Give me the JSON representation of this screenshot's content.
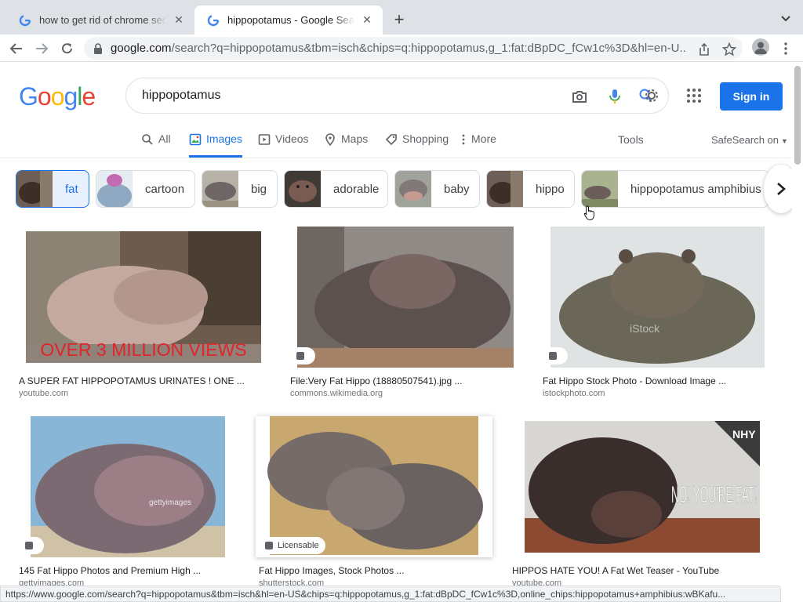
{
  "browser": {
    "tabs": [
      {
        "title": "how to get rid of chrome secur",
        "active": false
      },
      {
        "title": "hippopotamus - Google Search",
        "active": true
      }
    ],
    "url_host": "google.com",
    "url_path": "/search?q=hippopotamus&tbm=isch&chips=q:hippopotamus,g_1:fat:dBpDC_fCw1c%3D&hl=en-U..."
  },
  "header": {
    "logo": "Google",
    "query": "hippopotamus",
    "signin_label": "Sign in"
  },
  "nav": {
    "tabs": [
      {
        "label": "All",
        "icon": "search-icon"
      },
      {
        "label": "Images",
        "icon": "image-icon",
        "active": true
      },
      {
        "label": "Videos",
        "icon": "video-icon"
      },
      {
        "label": "Maps",
        "icon": "map-pin-icon"
      },
      {
        "label": "Shopping",
        "icon": "tag-icon"
      },
      {
        "label": "More",
        "icon": "more-vert-icon"
      }
    ],
    "tools": "Tools",
    "safesearch": "SafeSearch on"
  },
  "chips": [
    {
      "label": "fat",
      "selected": true
    },
    {
      "label": "cartoon"
    },
    {
      "label": "big"
    },
    {
      "label": "adorable"
    },
    {
      "label": "baby"
    },
    {
      "label": "hippo"
    },
    {
      "label": "hippopotamus amphibius"
    }
  ],
  "results": [
    {
      "title": "A SUPER FAT HIPPOPOTAMUS URINATES ! ONE ...",
      "source": "youtube.com",
      "overlay_text": "OVER 3 MILLION VIEWS"
    },
    {
      "title": "File:Very Fat Hippo (18880507541).jpg ...",
      "source": "commons.wikimedia.org"
    },
    {
      "title": "Fat Hippo Stock Photo - Download Image ...",
      "source": "istockphoto.com",
      "watermark": "iStock"
    },
    {
      "title": "145 Fat Hippo Photos and Premium High ...",
      "source": "gettyimages.com",
      "watermark": "gettyimages"
    },
    {
      "title": "Fat Hippo Images, Stock Photos ...",
      "source": "shutterstock.com",
      "badge": "Licensable"
    },
    {
      "title": "HIPPOS HATE YOU! A Fat Wet Teaser - YouTube",
      "source": "youtube.com",
      "overlay_text": "NO! YOU'RE FAT!",
      "corner_text": "NHY"
    }
  ],
  "status_url": "https://www.google.com/search?q=hippopotamus&tbm=isch&hl=en-US&chips=q:hippopotamus,g_1:fat:dBpDC_fCw1c%3D,online_chips:hippopotamus+amphibius:wBKafu...",
  "colors": {
    "accent": "#1a73e8",
    "google_blue": "#4285f4",
    "google_red": "#ea4335",
    "google_yellow": "#fbbc05",
    "google_green": "#34a853"
  }
}
